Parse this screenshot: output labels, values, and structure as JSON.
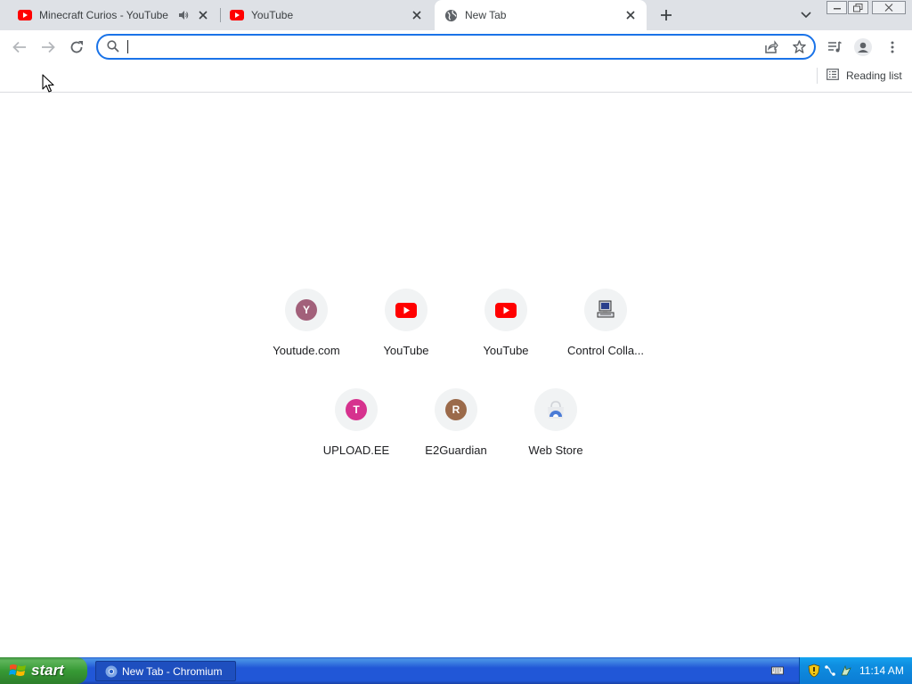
{
  "tabs": [
    {
      "title": "Minecraft Curios - YouTube",
      "favicon": "youtube-icon",
      "audio": "speaker-icon"
    },
    {
      "title": "YouTube",
      "favicon": "youtube-icon"
    },
    {
      "title": "New Tab",
      "favicon": "globe-icon",
      "active": true
    }
  ],
  "toolbar": {
    "omnibox_value": "",
    "back": "back-arrow-icon",
    "forward": "forward-arrow-icon",
    "reload": "reload-icon"
  },
  "bookmarks": {
    "reading_list": "Reading list"
  },
  "shortcuts": [
    {
      "label": "Youtude.com",
      "icon": "letter",
      "letter": "Y",
      "color": "#a2607a"
    },
    {
      "label": "YouTube",
      "icon": "youtube-icon"
    },
    {
      "label": "YouTube",
      "icon": "youtube-icon"
    },
    {
      "label": "Control Colla...",
      "icon": "computer-icon"
    },
    {
      "label": "UPLOAD.EE",
      "icon": "letter",
      "letter": "T",
      "color": "#d6328e"
    },
    {
      "label": "E2Guardian",
      "icon": "letter",
      "letter": "R",
      "color": "#9b6a4a"
    },
    {
      "label": "Web Store",
      "icon": "webstore-icon"
    }
  ],
  "taskbar": {
    "start": "start",
    "task_title": "New Tab - Chromium",
    "clock": "11:14 AM"
  },
  "colors": {
    "accent": "#1a73e8",
    "youtube_red": "#ff0000",
    "taskbar_blue": "#2157d7",
    "start_green": "#379a35"
  }
}
